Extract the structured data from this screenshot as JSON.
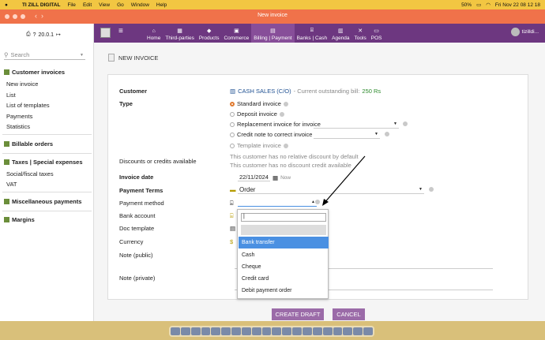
{
  "menubar": {
    "brand": "TI ZILL DIGITAL",
    "items": [
      "File",
      "Edit",
      "View",
      "Go",
      "Window",
      "Help"
    ],
    "battery": "50%",
    "datetime": "Fri Nov 22  08 12 18"
  },
  "window": {
    "title": "New invoice"
  },
  "sidebar": {
    "version": "20.0.1",
    "search_placeholder": "Search",
    "sections": [
      {
        "title": "Customer invoices",
        "items": [
          "New invoice",
          "List",
          "List of templates",
          "Payments",
          "Statistics"
        ]
      },
      {
        "title": "Billable orders",
        "items": []
      },
      {
        "title": "Taxes | Special expenses",
        "items": [
          "Social/fiscal taxes",
          "VAT"
        ]
      },
      {
        "title": "Miscellaneous payments",
        "items": []
      },
      {
        "title": "Margins",
        "items": []
      }
    ]
  },
  "topnav": {
    "items": [
      {
        "label": "Home",
        "icon": "home-icon"
      },
      {
        "label": "Third-parties",
        "icon": "building-icon"
      },
      {
        "label": "Products",
        "icon": "cube-icon"
      },
      {
        "label": "Commerce",
        "icon": "briefcase-icon"
      },
      {
        "label": "Billing | Payment",
        "icon": "money-icon"
      },
      {
        "label": "Banks | Cash",
        "icon": "bank-icon"
      },
      {
        "label": "Agenda",
        "icon": "calendar-icon"
      },
      {
        "label": "Tools",
        "icon": "tools-icon"
      },
      {
        "label": "POS",
        "icon": "monitor-icon"
      }
    ],
    "active": "Billing | Payment",
    "user": "tizilldi..."
  },
  "page": {
    "title": "NEW INVOICE"
  },
  "form": {
    "customer_label": "Customer",
    "customer_value": "CASH SALES (C/O)",
    "outstanding_label": "- Current outstanding bill:",
    "outstanding_value": "250 Rs",
    "type_label": "Type",
    "type_options": [
      "Standard invoice",
      "Deposit invoice",
      "Replacement invoice for invoice",
      "Credit note to correct invoice",
      "Template invoice"
    ],
    "type_selected": "Standard invoice",
    "discounts_label": "Discounts or credits available",
    "discount_line1": "This customer has no relative discount by default",
    "discount_line2": "This customer has no discount credit available",
    "invoice_date_label": "Invoice date",
    "invoice_date": "22/11/2024",
    "now_label": "Now",
    "payment_terms_label": "Payment Terms",
    "payment_terms_value": "Order",
    "payment_method_label": "Payment method",
    "bank_account_label": "Bank account",
    "doc_template_label": "Doc template",
    "currency_label": "Currency",
    "currency_symbol": "$",
    "note_public_label": "Note (public)",
    "note_private_label": "Note (private)"
  },
  "dropdown": {
    "input_value": "|",
    "options": [
      "Bank transfer",
      "Cash",
      "Cheque",
      "Credit card",
      "Debit payment order"
    ],
    "highlighted": "Bank transfer"
  },
  "buttons": {
    "create_draft": "CREATE DRAFT",
    "cancel": "CANCEL"
  },
  "colors": {
    "accent": "#6d3780",
    "titlebar": "#f0724a",
    "button": "#9b6ba8",
    "highlight": "#4a90e2"
  }
}
